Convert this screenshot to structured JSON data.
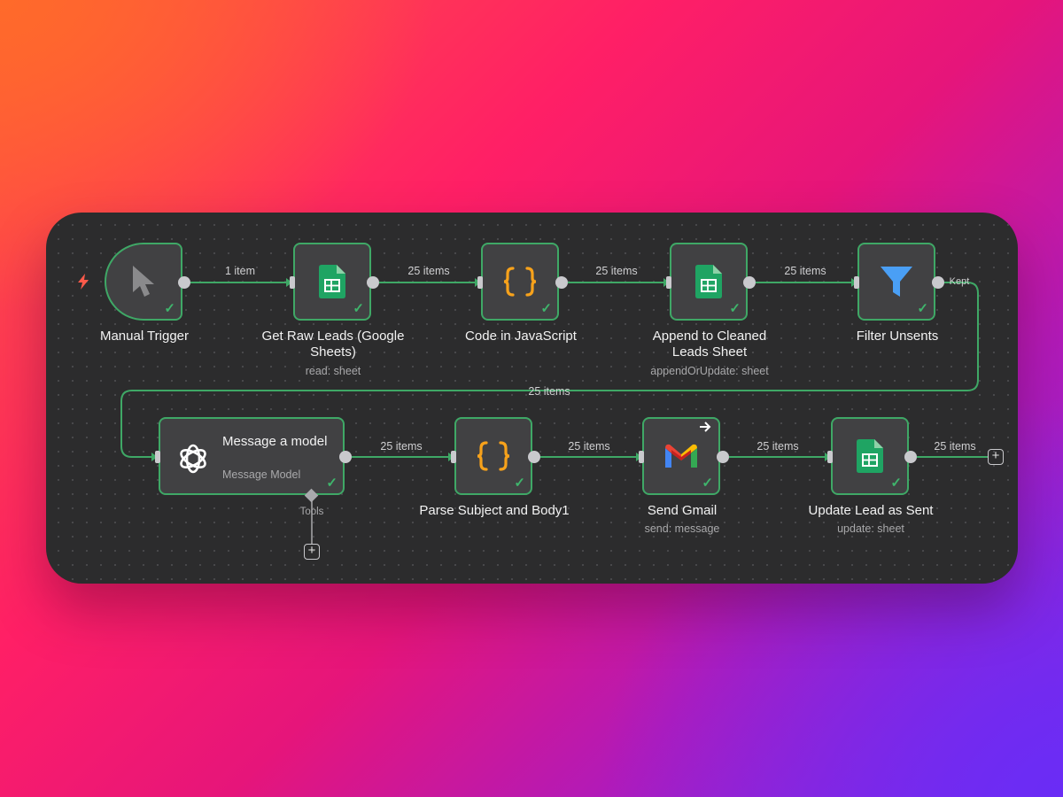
{
  "workflow": {
    "nodes": [
      {
        "id": "manual-trigger",
        "title": "Manual Trigger",
        "subtitle": ""
      },
      {
        "id": "get-raw-leads",
        "title": "Get Raw Leads (Google Sheets)",
        "subtitle": "read: sheet"
      },
      {
        "id": "code-js",
        "title": "Code in JavaScript",
        "subtitle": ""
      },
      {
        "id": "append-cleaned",
        "title": "Append to Cleaned Leads Sheet",
        "subtitle": "appendOrUpdate: sheet"
      },
      {
        "id": "filter-unsents",
        "title": "Filter Unsents",
        "subtitle": ""
      },
      {
        "id": "message-model",
        "title": "Message a model",
        "subtitle": "Message Model"
      },
      {
        "id": "parse-subject",
        "title": "Parse Subject and Body1",
        "subtitle": ""
      },
      {
        "id": "send-gmail",
        "title": "Send Gmail",
        "subtitle": "send: message"
      },
      {
        "id": "update-lead",
        "title": "Update Lead as Sent",
        "subtitle": "update: sheet"
      }
    ],
    "edge_labels": [
      "1 item",
      "25 items",
      "25 items",
      "25 items",
      "25 items",
      "25 items",
      "25 items",
      "25 items",
      "25 items"
    ],
    "branch_label": "Kept",
    "tools_label": "Tools",
    "check_glyph": "✓",
    "plus_glyph": "+",
    "icons": [
      "cursor-icon",
      "google-sheets-icon",
      "code-braces-icon",
      "filter-funnel-icon",
      "openai-icon",
      "gmail-icon",
      "lightning-icon",
      "arrow-right-icon"
    ]
  },
  "colors": {
    "connection": "#3fa866",
    "success_check": "#3fb56c",
    "code_icon": "#f7a21b",
    "filter_icon": "#4a9ff5",
    "sheets_green": "#1fa463",
    "trigger_bolt": "#ff5a4a"
  }
}
